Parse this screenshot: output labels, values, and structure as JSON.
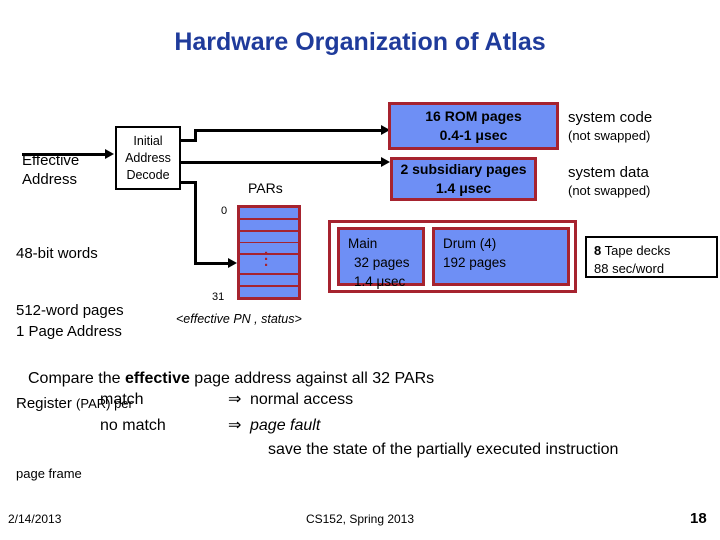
{
  "slide": {
    "title": "Hardware Organization of Atlas",
    "page_number": "18"
  },
  "diagram": {
    "effective_address_label": "Effective\nAddress",
    "initial_address_decode": {
      "line1": "Initial",
      "line2": "Address",
      "line3": "Decode"
    },
    "specs": {
      "line1": "48-bit words",
      "line2": "512-word pages"
    },
    "par_note": {
      "line1": "1 Page Address",
      "line2_prefix": "Register ",
      "line2_paren": "(PAR) per",
      "line3": "page frame"
    },
    "pars": {
      "title": "PARs",
      "index_first": "0",
      "index_last": "31",
      "caption": "<effective PN , status>",
      "row_count": 7
    },
    "rom_box": {
      "line1": "16 ROM pages",
      "line2": "0.4-1 μsec"
    },
    "rom_label": {
      "line1": "system code",
      "line2": "(not swapped)"
    },
    "subsidiary_box": {
      "line1": "2 subsidiary pages",
      "line2": "1.4 μsec"
    },
    "subsidiary_label": {
      "line1": "system data",
      "line2": "(not swapped)"
    },
    "main_box": {
      "line1": "Main",
      "line2": "32 pages",
      "line3": "1.4 μsec"
    },
    "drum_box": {
      "line1": "Drum (4)",
      "line2": "192 pages"
    },
    "tape_box": {
      "line1_bold": "8",
      "line1_rest": " Tape decks",
      "line2": "88 sec/word"
    }
  },
  "explanation": {
    "line1_a": "Compare the ",
    "line1_b": "effective",
    "line1_c": " page address against all 32 PARs",
    "match_label": "match",
    "match_arrow": "⇒",
    "match_result": "normal access",
    "nomatch_label": "no match",
    "nomatch_arrow": "⇒",
    "nomatch_result": "page fault",
    "save_state": "save the state of the partially executed instruction"
  },
  "footer": {
    "date": "2/14/2013",
    "course": "CS152, Spring 2013"
  },
  "colors": {
    "title_blue": "#1F3B9B",
    "box_fill_blue": "#6E8FF5",
    "box_border_red": "#A6232F",
    "line_black": "#000000"
  }
}
